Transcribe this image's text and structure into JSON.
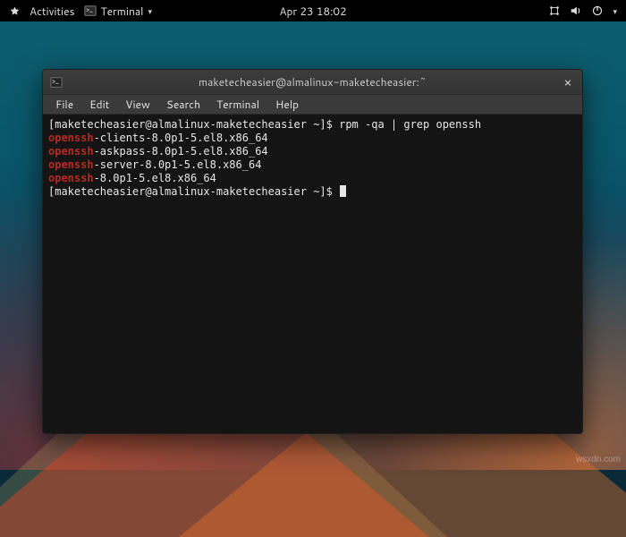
{
  "topbar": {
    "activities_label": "Activities",
    "app_name": "Terminal",
    "datetime": "Apr 23  18:02"
  },
  "window": {
    "title": "maketecheasier@almalinux-maketecheasier:~"
  },
  "menubar": {
    "items": [
      "File",
      "Edit",
      "View",
      "Search",
      "Terminal",
      "Help"
    ]
  },
  "terminal": {
    "prompt1_prefix": "[maketecheasier@almalinux-maketecheasier ~]$ ",
    "command1": "rpm -qa | grep openssh",
    "results": [
      {
        "match": "openssh",
        "rest": "-clients-8.0p1-5.el8.x86_64"
      },
      {
        "match": "openssh",
        "rest": "-askpass-8.0p1-5.el8.x86_64"
      },
      {
        "match": "openssh",
        "rest": "-server-8.0p1-5.el8.x86_64"
      },
      {
        "match": "openssh",
        "rest": "-8.0p1-5.el8.x86_64"
      }
    ],
    "prompt2_prefix": "[maketecheasier@almalinux-maketecheasier ~]$ "
  },
  "watermark": "wsxdn.com"
}
